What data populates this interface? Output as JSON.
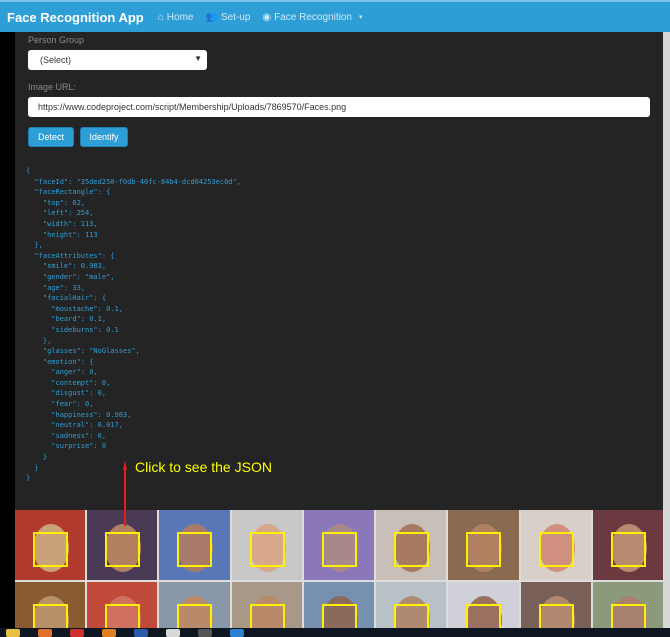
{
  "navbar": {
    "brand": "Face Recognition App",
    "links": [
      {
        "icon": "home-icon",
        "label": "Home"
      },
      {
        "icon": "users-icon",
        "label": "Set-up"
      },
      {
        "icon": "eye-icon",
        "label": "Face Recognition"
      }
    ]
  },
  "form": {
    "person_group_label": "Person Group",
    "person_group_value": "(Select)",
    "image_url_label": "Image URL:",
    "image_url_value": "https://www.codeproject.com/script/Membership/Uploads/7869570/Faces.png",
    "detect_label": "Detect",
    "identify_label": "Identify"
  },
  "json_output": "{\n  \"faceId\": \"35ded250-f0db-40fc-84b4-dcd04253ec0d\",\n  \"faceRectangle\": {\n    \"top\": 62,\n    \"left\": 254,\n    \"width\": 113,\n    \"height\": 113\n  },\n  \"faceAttributes\": {\n    \"smile\": 0.983,\n    \"gender\": \"male\",\n    \"age\": 33,\n    \"facialHair\": {\n      \"moustache\": 0.1,\n      \"beard\": 0.1,\n      \"sideburns\": 0.1\n    },\n    \"glasses\": \"NoGlasses\",\n    \"emotion\": {\n      \"anger\": 0,\n      \"contempt\": 0,\n      \"disgust\": 0,\n      \"fear\": 0,\n      \"happiness\": 0.983,\n      \"neutral\": 0.017,\n      \"sadness\": 0,\n      \"surprise\": 0\n    }\n  }\n}",
  "annotation": "Click to see the JSON",
  "faces": [
    {
      "bg": "#b03a2e",
      "skin": "#c9a27a"
    },
    {
      "bg": "#4a3a55",
      "skin": "#b08060"
    },
    {
      "bg": "#5a78b8",
      "skin": "#a87a6a"
    },
    {
      "bg": "#c8c8c8",
      "skin": "#d7a88a"
    },
    {
      "bg": "#8a78b8",
      "skin": "#a88888"
    },
    {
      "bg": "#c8c0b8",
      "skin": "#a57a5e"
    },
    {
      "bg": "#8a6a50",
      "skin": "#b08060"
    },
    {
      "bg": "#d8d0c8",
      "skin": "#d09080"
    },
    {
      "bg": "#6a3a40",
      "skin": "#b88a70"
    },
    {
      "bg": "#8a5a30",
      "skin": "#b8906a"
    },
    {
      "bg": "#c04a3a",
      "skin": "#d07060"
    },
    {
      "bg": "#8898a8",
      "skin": "#b88a6a"
    },
    {
      "bg": "#a89888",
      "skin": "#b88a6a"
    },
    {
      "bg": "#7890b0",
      "skin": "#8a6a5a"
    },
    {
      "bg": "#b8c0c8",
      "skin": "#b08a70"
    },
    {
      "bg": "#d0d0d8",
      "skin": "#9a7060"
    },
    {
      "bg": "#786058",
      "skin": "#b08870"
    },
    {
      "bg": "#8a9a7a",
      "skin": "#a88070"
    }
  ]
}
